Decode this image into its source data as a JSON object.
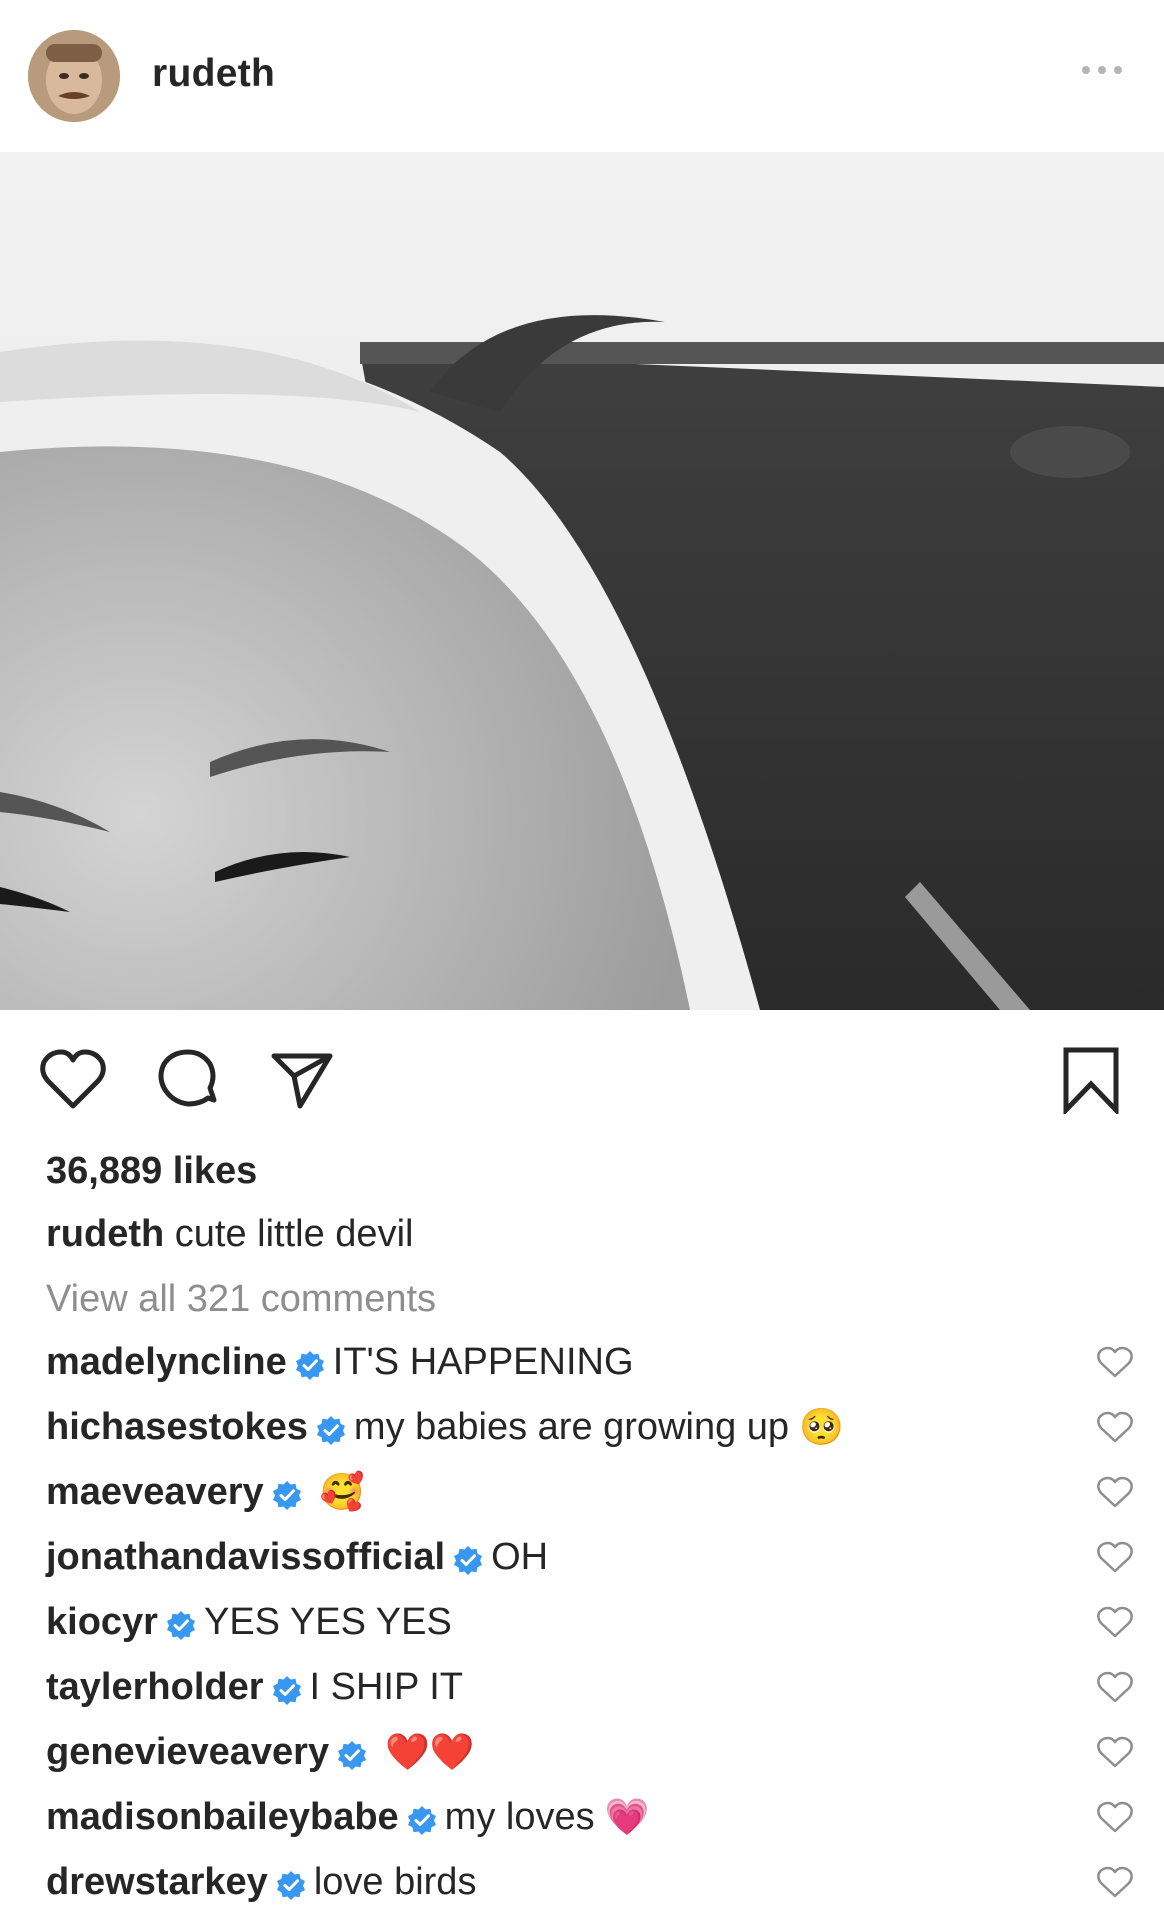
{
  "post": {
    "username": "rudeth",
    "likes": "36,889 likes",
    "caption_user": "rudeth",
    "caption_text": "cute little devil",
    "view_all": "View all 321 comments"
  },
  "icons": {
    "more": "more-options-icon",
    "like": "heart-icon",
    "comment": "comment-bubble-icon",
    "share": "paper-plane-icon",
    "save": "bookmark-icon",
    "verified": "verified-badge-icon"
  },
  "colors": {
    "text": "#262626",
    "muted": "#8e8e8e",
    "verified": "#3897f0"
  },
  "comments": [
    {
      "user": "madelyncline",
      "text": "IT'S HAPPENING",
      "emoji": ""
    },
    {
      "user": "hichasestokes",
      "text": "my babies are growing up",
      "emoji": "🥺"
    },
    {
      "user": "maeveavery",
      "text": "",
      "emoji": "🥰"
    },
    {
      "user": "jonathandavissofficial",
      "text": "OH",
      "emoji": ""
    },
    {
      "user": "kiocyr",
      "text": "YES YES YES",
      "emoji": ""
    },
    {
      "user": "taylerholder",
      "text": "I SHIP IT",
      "emoji": ""
    },
    {
      "user": "genevieveavery",
      "text": "",
      "emoji": "❤️❤️"
    },
    {
      "user": "madisonbaileybabe",
      "text": "my loves",
      "emoji": "💗"
    },
    {
      "user": "drewstarkey",
      "text": "love birds",
      "emoji": ""
    }
  ]
}
